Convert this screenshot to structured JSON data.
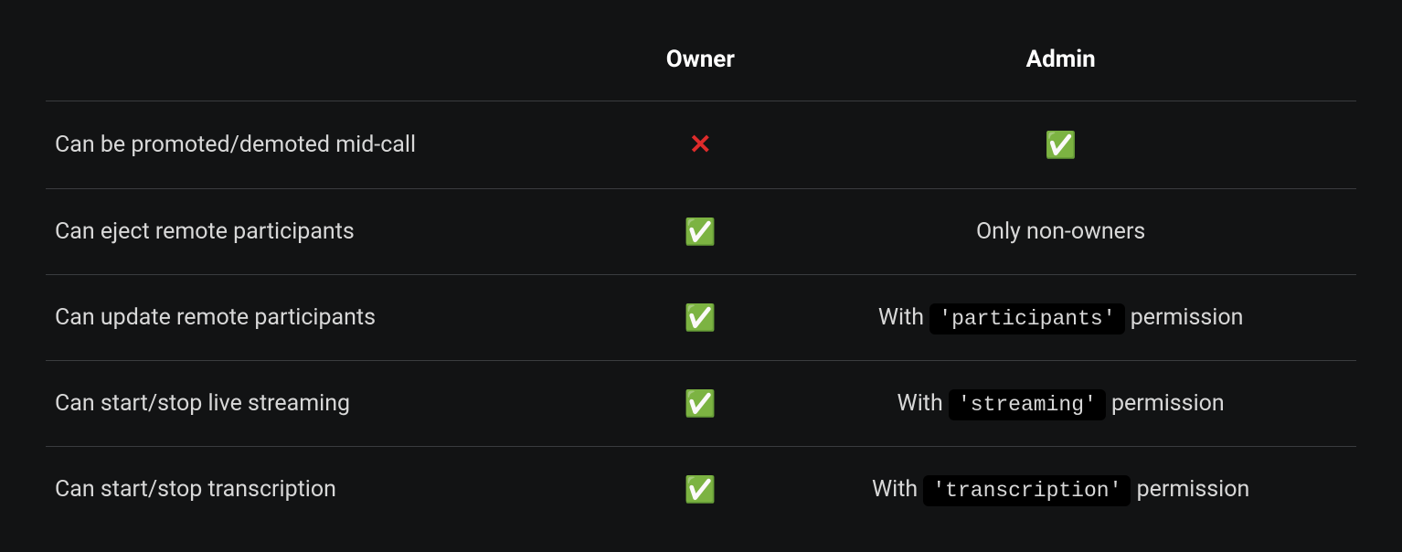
{
  "table": {
    "headers": {
      "label": "",
      "owner": "Owner",
      "admin": "Admin"
    },
    "rows": [
      {
        "label": "Can be promoted/demoted mid-call",
        "owner": {
          "type": "cross"
        },
        "admin": {
          "type": "check"
        }
      },
      {
        "label": "Can eject remote participants",
        "owner": {
          "type": "check"
        },
        "admin": {
          "type": "text",
          "text": "Only non-owners"
        }
      },
      {
        "label": "Can update remote participants",
        "owner": {
          "type": "check"
        },
        "admin": {
          "type": "withperm",
          "prefix": "With ",
          "code": "'participants'",
          "suffix": " permission"
        }
      },
      {
        "label": "Can start/stop live streaming",
        "owner": {
          "type": "check"
        },
        "admin": {
          "type": "withperm",
          "prefix": "With ",
          "code": "'streaming'",
          "suffix": " permission"
        }
      },
      {
        "label": "Can start/stop transcription",
        "owner": {
          "type": "check"
        },
        "admin": {
          "type": "withperm",
          "prefix": "With ",
          "code": "'transcription'",
          "suffix": " permission"
        }
      }
    ]
  }
}
